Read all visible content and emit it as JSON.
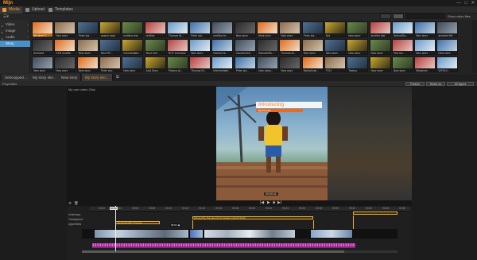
{
  "app": {
    "logo": "Mijn"
  },
  "window_controls": [
    "—",
    "□",
    "✕"
  ],
  "top_tabs": [
    {
      "label": "Media",
      "active": true,
      "icon": "media-icon"
    },
    {
      "label": "Upload",
      "active": false,
      "icon": "upload-icon"
    },
    {
      "label": "Templates",
      "active": false,
      "icon": "templates-icon"
    }
  ],
  "filter": {
    "label": "Show video files"
  },
  "sidebar": {
    "items": [
      {
        "label": "Video",
        "active": false
      },
      {
        "label": "Image",
        "active": false
      },
      {
        "label": "Audio",
        "active": false
      },
      {
        "label": "Story",
        "active": true
      }
    ]
  },
  "media": {
    "row1": [
      "My story C...",
      "New story",
      "Peter sta...",
      "search data",
      "profiling test",
      "profiles",
      "Thomas Ni...",
      "Peter sta...",
      "profiling te...",
      "New story",
      "Mark story",
      "New story",
      "Peter sta...",
      "Not",
      "New story",
      "another test",
      "Debug/Da...",
      "New story",
      "archived file"
    ],
    "row2": [
      "Archived",
      "XXR test/Be...",
      "New story",
      "New RF...",
      "Intermediate...",
      "More test",
      "RCF encoding",
      "New story",
      "Internet st...",
      "Canned test",
      "Sample/Ba...",
      "Thomas Ni...",
      "Nice story",
      "New story",
      "New story",
      "New story",
      "Test set...",
      "New story",
      "New story"
    ],
    "row3": [
      "New story",
      "New story",
      "New story",
      "Peter sta...",
      "New story",
      "AAA Story",
      "Playing wi...",
      "Thomas Ni...",
      "Intermediate...",
      "Peter sta...",
      "Ugly dog/u...",
      "New story",
      "MediaCrab...",
      "TCH",
      "Testing",
      "New story",
      "New story",
      "Whatever...",
      "WFS10..."
    ]
  },
  "doc_tabs": [
    {
      "label": "Setroopped ...",
      "active": false
    },
    {
      "label": "My story ske...",
      "active": false
    },
    {
      "label": "New story",
      "active": false
    },
    {
      "label": "My story sko...",
      "active": true
    }
  ],
  "properties": {
    "label": "Properties",
    "buttons": [
      "Publish",
      "Share as",
      "All layers"
    ]
  },
  "viewer": {
    "title": "My own video Ohio",
    "overlay_title": "Introducing",
    "overlay_subtitle": "My Thomas",
    "timecode": "00:00:11"
  },
  "transport": {
    "prev": "|◀",
    "play": "▶",
    "next": "▶|",
    "stop": "■"
  },
  "timeline": {
    "playhead_label": "00:04",
    "ticks": [
      "00:02",
      "00:04",
      "00:06",
      "00:08",
      "00:10",
      "00:12",
      "00:14",
      "00:16",
      "00:18",
      "00:20",
      "00:22",
      "00:24",
      "00:26",
      "00:28",
      "00:30",
      "00:32",
      "00:34",
      "00:36",
      "00:38"
    ],
    "track_labels": [
      "Underlays",
      "Transparent",
      "Uppertitles"
    ],
    "overlays": [
      {
        "label": "Introducing/My Thomas"
      },
      {
        "label": "Playing/XA Tha plies the Fountains (what? Work)"
      },
      {
        "label": ""
      }
    ],
    "clip_label": "00:04 ◀"
  }
}
